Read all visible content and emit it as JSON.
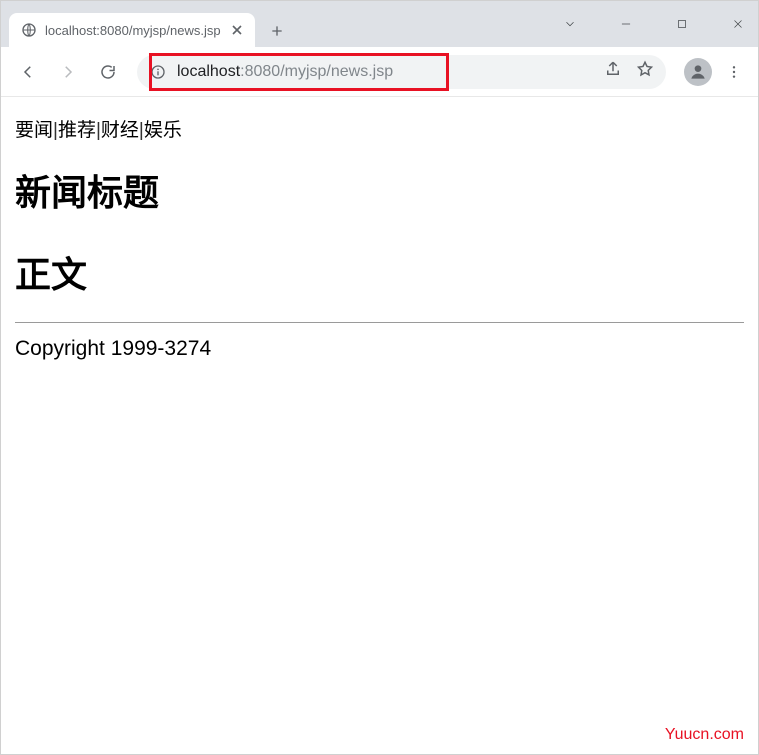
{
  "browser": {
    "tab_title": "localhost:8080/myjsp/news.jsp",
    "address": {
      "host_prefix": "localhost",
      "host_suffix": ":8080",
      "path": "/myjsp/news.jsp"
    }
  },
  "page": {
    "nav_items": [
      "要闻",
      "推荐",
      "财经",
      "娱乐"
    ],
    "heading": "新闻标题",
    "body_heading": "正文",
    "copyright": "Copyright 1999-3274"
  },
  "watermark": "Yuucn.com"
}
